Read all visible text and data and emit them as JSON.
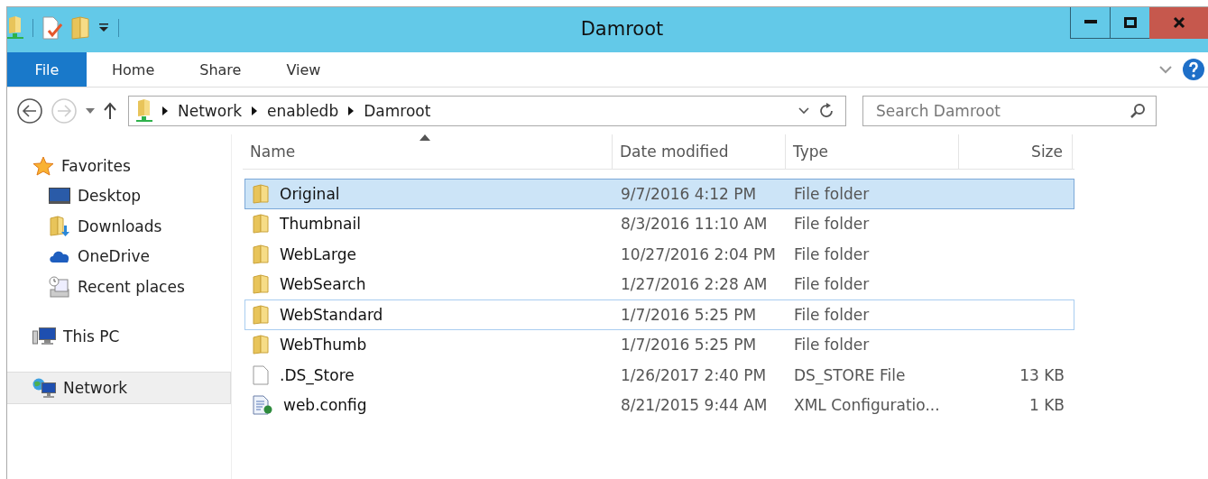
{
  "window": {
    "title": "Damroot"
  },
  "quick_access": [
    {
      "kind": "network"
    },
    {
      "kind": "properties"
    },
    {
      "kind": "folder"
    },
    {
      "kind": "customize"
    }
  ],
  "ribbon_tabs": [
    {
      "label": "File",
      "selected": true
    },
    {
      "label": "Home",
      "selected": false
    },
    {
      "label": "Share",
      "selected": false
    },
    {
      "label": "View",
      "selected": false
    }
  ],
  "navigation": {
    "back_disabled": false,
    "forward_disabled": true
  },
  "address": {
    "path": [
      "Network",
      "enabledb",
      "Damroot"
    ]
  },
  "search": {
    "placeholder": "Search Damroot"
  },
  "sidebar": [
    {
      "label": "Favorites",
      "kind": "star",
      "selected": false,
      "children": [
        {
          "label": "Desktop",
          "kind": "desktop",
          "selected": false
        },
        {
          "label": "Downloads",
          "kind": "downloads",
          "selected": false
        },
        {
          "label": "OneDrive",
          "kind": "cloud",
          "selected": false
        },
        {
          "label": "Recent places",
          "kind": "recent",
          "selected": false
        }
      ]
    },
    {
      "label": "This PC",
      "kind": "pc",
      "selected": false
    },
    {
      "label": "Network",
      "kind": "network",
      "selected": true
    }
  ],
  "table": {
    "columns": [
      {
        "label": "Name",
        "sorted": true
      },
      {
        "label": "Date modified",
        "sorted": false
      },
      {
        "label": "Type",
        "sorted": false
      },
      {
        "label": "Size",
        "sorted": false
      }
    ],
    "rows": [
      {
        "name": "Original",
        "kind": "folder",
        "date": "9/7/2016 4:12 PM",
        "type": "File folder",
        "selected": true,
        "focused": false
      },
      {
        "name": "Thumbnail",
        "kind": "folder",
        "date": "8/3/2016 11:10 AM",
        "type": "File folder",
        "selected": false,
        "focused": false
      },
      {
        "name": "WebLarge",
        "kind": "folder",
        "date": "10/27/2016 2:04 PM",
        "type": "File folder",
        "selected": false,
        "focused": false
      },
      {
        "name": "WebSearch",
        "kind": "folder",
        "date": "1/27/2016 2:28 AM",
        "type": "File folder",
        "selected": false,
        "focused": false
      },
      {
        "name": "WebStandard",
        "kind": "folder",
        "date": "1/7/2016 5:25 PM",
        "type": "File folder",
        "selected": false,
        "focused": true
      },
      {
        "name": "WebThumb",
        "kind": "folder",
        "date": "1/7/2016 5:25 PM",
        "type": "File folder",
        "selected": false,
        "focused": false
      },
      {
        "name": ".DS_Store",
        "kind": "file",
        "date": "1/26/2017 2:40 PM",
        "type": "DS_STORE File",
        "size": "13 KB",
        "selected": false,
        "focused": false
      },
      {
        "name": "web.config",
        "kind": "config",
        "date": "8/21/2015 9:44 AM",
        "type": "XML Configuratio...",
        "size": "1 KB",
        "selected": false,
        "focused": false
      }
    ]
  }
}
